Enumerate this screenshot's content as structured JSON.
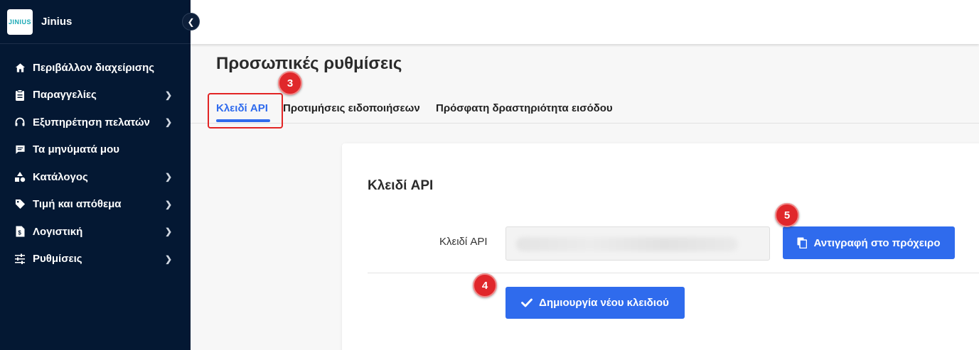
{
  "brand": {
    "logo_text": "JINIUS",
    "name": "Jinius"
  },
  "sidebar": {
    "items": [
      {
        "label": "Περιβάλλον διαχείρισης",
        "icon": "home-icon",
        "has_children": false
      },
      {
        "label": "Παραγγελίες",
        "icon": "clipboard-icon",
        "has_children": true
      },
      {
        "label": "Εξυπηρέτηση πελατών",
        "icon": "headset-icon",
        "has_children": true
      },
      {
        "label": "Τα μηνύματά μου",
        "icon": "message-icon",
        "has_children": false
      },
      {
        "label": "Κατάλογος",
        "icon": "shapes-icon",
        "has_children": true
      },
      {
        "label": "Τιμή και απόθεμα",
        "icon": "tag-icon",
        "has_children": true
      },
      {
        "label": "Λογιστική",
        "icon": "invoice-icon",
        "has_children": true
      },
      {
        "label": "Ρυθμίσεις",
        "icon": "sliders-icon",
        "has_children": true
      }
    ]
  },
  "page": {
    "title": "Προσωπικές ρυθμίσεις"
  },
  "tabs": [
    {
      "label": "Κλειδί API",
      "active": true
    },
    {
      "label": "Προτιμήσεις ειδοποιήσεων",
      "active": false
    },
    {
      "label": "Πρόσφατη δραστηριότητα εισόδου",
      "active": false
    }
  ],
  "card": {
    "title": "Κλειδί API",
    "field_label": "Κλειδί API",
    "key_value": "",
    "copy_button": "Αντιγραφή στο πρόχειρο",
    "new_key_button": "Δημιουργία νέου κλειδιού"
  },
  "badges": {
    "tab": "3",
    "new_key": "4",
    "copy": "5"
  },
  "colors": {
    "sidebar_bg": "#041833",
    "accent": "#2f6bed",
    "badge": "#e0272b"
  }
}
